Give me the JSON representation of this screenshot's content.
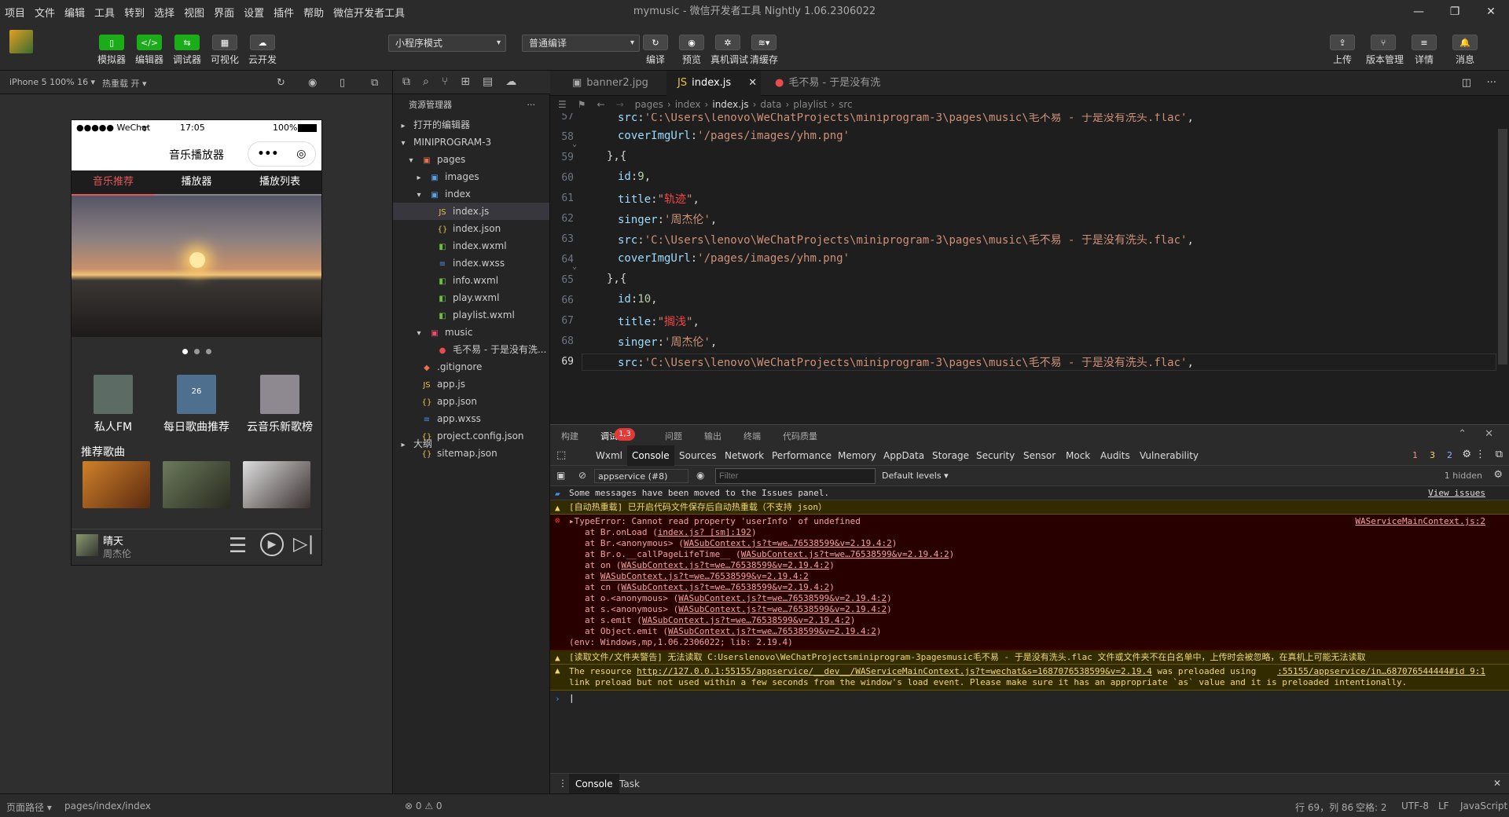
{
  "menu": [
    "项目",
    "文件",
    "编辑",
    "工具",
    "转到",
    "选择",
    "视图",
    "界面",
    "设置",
    "插件",
    "帮助",
    "微信开发者工具"
  ],
  "window": {
    "title": "mymusic - 微信开发者工具 Nightly 1.06.2306022",
    "controls": [
      "—",
      "❐",
      "✕"
    ]
  },
  "toolbar": {
    "left": [
      {
        "label": "模拟器",
        "glyph": "▯"
      },
      {
        "label": "编辑器",
        "glyph": "</>"
      },
      {
        "label": "调试器",
        "glyph": "⇆"
      },
      {
        "label": "可视化",
        "glyph": "▦"
      },
      {
        "label": "云开发",
        "glyph": "☁"
      }
    ],
    "mode_select": "小程序模式",
    "compile_select": "普通编译",
    "mid": [
      {
        "label": "编译",
        "glyph": "↻"
      },
      {
        "label": "预览",
        "glyph": "◉"
      },
      {
        "label": "真机调试",
        "glyph": "✲"
      },
      {
        "label": "清缓存",
        "glyph": "≋▾"
      }
    ],
    "right": [
      {
        "label": "上传",
        "glyph": "⇪"
      },
      {
        "label": "版本管理",
        "glyph": "⑂"
      },
      {
        "label": "详情",
        "glyph": "≡"
      },
      {
        "label": "消息",
        "glyph": "🔔"
      }
    ]
  },
  "simbar": {
    "device": "iPhone 5 100% 16 ▾",
    "hotreload": "热重载 开 ▾"
  },
  "phone": {
    "carrier": "●●●●● WeChat",
    "wifi": "ᯤ",
    "time": "17:05",
    "battery": "100%",
    "title": "音乐播放器",
    "capsule_more": "•••",
    "capsule_close": "◎",
    "tabs": [
      "音乐推荐",
      "播放器",
      "播放列表"
    ],
    "icons": [
      {
        "label": "私人FM",
        "color": "#5c6b64"
      },
      {
        "label": "每日歌曲推荐",
        "color": "#4e6f8e",
        "badge": "26"
      },
      {
        "label": "云音乐新歌榜",
        "color": "#8e8890"
      }
    ],
    "recommend": "推荐歌曲",
    "song": {
      "name": "晴天",
      "singer": "周杰伦"
    }
  },
  "explorer": {
    "title": "资源管理器",
    "more": "···",
    "open_editors": "打开的编辑器",
    "project": "MINIPROGRAM-3",
    "outline": "大纲",
    "tree": [
      {
        "name": "pages",
        "icon": "▣",
        "color": "#e8714b",
        "level": 1,
        "arrow": "▾"
      },
      {
        "name": "images",
        "icon": "▣",
        "color": "#5aa0e8",
        "level": 2,
        "arrow": "▸"
      },
      {
        "name": "index",
        "icon": "▣",
        "color": "#5aa0e8",
        "level": 2,
        "arrow": "▾"
      },
      {
        "name": "index.js",
        "icon": "JS",
        "color": "#e8c34b",
        "level": 3,
        "active": true
      },
      {
        "name": "index.json",
        "icon": "{}",
        "color": "#e8c34b",
        "level": 3
      },
      {
        "name": "index.wxml",
        "icon": "◧",
        "color": "#6abf40",
        "level": 3
      },
      {
        "name": "index.wxss",
        "icon": "≡",
        "color": "#4b8fe8",
        "level": 3
      },
      {
        "name": "info.wxml",
        "icon": "◧",
        "color": "#6abf40",
        "level": 3
      },
      {
        "name": "play.wxml",
        "icon": "◧",
        "color": "#6abf40",
        "level": 3
      },
      {
        "name": "playlist.wxml",
        "icon": "◧",
        "color": "#6abf40",
        "level": 3
      },
      {
        "name": "music",
        "icon": "▣",
        "color": "#e84b6f",
        "level": 2,
        "arrow": "▾"
      },
      {
        "name": "毛不易 - 于是没有洗...",
        "icon": "●",
        "color": "#e84b4b",
        "level": 3
      },
      {
        "name": ".gitignore",
        "icon": "◆",
        "color": "#e8714b",
        "level": 1
      },
      {
        "name": "app.js",
        "icon": "JS",
        "color": "#e8c34b",
        "level": 1
      },
      {
        "name": "app.json",
        "icon": "{}",
        "color": "#e8c34b",
        "level": 1
      },
      {
        "name": "app.wxss",
        "icon": "≡",
        "color": "#4b8fe8",
        "level": 1
      },
      {
        "name": "project.config.json",
        "icon": "{}",
        "color": "#e8c34b",
        "level": 1
      },
      {
        "name": "sitemap.json",
        "icon": "{}",
        "color": "#e8c34b",
        "level": 1
      }
    ]
  },
  "editor": {
    "tabs": [
      {
        "name": "banner2.jpg",
        "icon": "▣"
      },
      {
        "name": "index.js",
        "icon": "JS",
        "active": true,
        "close": "✕"
      },
      {
        "name": "毛不易 - 于是没有洗头.flac",
        "icon": "●"
      }
    ],
    "breadcrumb": [
      "pages",
      "index",
      "index.js",
      "data",
      "playlist",
      "src"
    ],
    "lines": [
      {
        "n": "57",
        "parts": [
          [
            "p",
            "src"
          ],
          [
            "d",
            ":"
          ],
          [
            "s",
            "'C:\\Users\\lenovo\\WeChatProjects\\miniprogram-3\\pages\\music\\毛不易 - 于是没有洗头.flac'"
          ],
          [
            "d",
            ","
          ]
        ]
      },
      {
        "n": "58",
        "parts": [
          [
            "p",
            "coverImgUrl"
          ],
          [
            "d",
            ":"
          ],
          [
            "s",
            "'/pages/images/yhm.png'"
          ]
        ]
      },
      {
        "n": "59",
        "parts": [
          [
            "d",
            "},{"
          ]
        ],
        "indent": -1
      },
      {
        "n": "60",
        "parts": [
          [
            "p",
            "id"
          ],
          [
            "d",
            ":"
          ],
          [
            "n",
            "9"
          ],
          [
            "d",
            ","
          ]
        ]
      },
      {
        "n": "61",
        "parts": [
          [
            "p",
            "title"
          ],
          [
            "d",
            ":"
          ],
          [
            "s",
            "\""
          ],
          [
            "r",
            "轨迹"
          ],
          [
            "s",
            "\""
          ],
          [
            "d",
            ","
          ]
        ]
      },
      {
        "n": "62",
        "parts": [
          [
            "p",
            "singer"
          ],
          [
            "d",
            ":"
          ],
          [
            "s",
            "'周杰伦'"
          ],
          [
            "d",
            ","
          ]
        ]
      },
      {
        "n": "63",
        "parts": [
          [
            "p",
            "src"
          ],
          [
            "d",
            ":"
          ],
          [
            "s",
            "'C:\\Users\\lenovo\\WeChatProjects\\miniprogram-3\\pages\\music\\毛不易 - 于是没有洗头.flac'"
          ],
          [
            "d",
            ","
          ]
        ]
      },
      {
        "n": "64",
        "parts": [
          [
            "p",
            "coverImgUrl"
          ],
          [
            "d",
            ":"
          ],
          [
            "s",
            "'/pages/images/yhm.png'"
          ]
        ]
      },
      {
        "n": "65",
        "parts": [
          [
            "d",
            "},{"
          ]
        ],
        "indent": -1
      },
      {
        "n": "66",
        "parts": [
          [
            "p",
            "id"
          ],
          [
            "d",
            ":"
          ],
          [
            "n",
            "10"
          ],
          [
            "d",
            ","
          ]
        ]
      },
      {
        "n": "67",
        "parts": [
          [
            "p",
            "title"
          ],
          [
            "d",
            ":"
          ],
          [
            "s",
            "\""
          ],
          [
            "r",
            "搁浅"
          ],
          [
            "s",
            "\""
          ],
          [
            "d",
            ","
          ]
        ]
      },
      {
        "n": "68",
        "parts": [
          [
            "p",
            "singer"
          ],
          [
            "d",
            ":"
          ],
          [
            "s",
            "'周杰伦'"
          ],
          [
            "d",
            ","
          ]
        ]
      },
      {
        "n": "69",
        "parts": [
          [
            "p",
            "src"
          ],
          [
            "d",
            ":"
          ],
          [
            "s",
            "'C:\\Users\\lenovo\\WeChatProjects\\miniprogram-3\\pages\\music\\毛不易 - 于是没有洗头.flac'"
          ],
          [
            "d",
            ","
          ]
        ]
      }
    ]
  },
  "console": {
    "top_tabs": [
      "构建",
      "调试器",
      "问题",
      "输出",
      "终端",
      "代码质量"
    ],
    "badge": "1,3",
    "tabs": [
      "Wxml",
      "Console",
      "Sources",
      "Network",
      "Performance",
      "Memory",
      "AppData",
      "Storage",
      "Security",
      "Sensor",
      "Mock",
      "Audits",
      "Vulnerability"
    ],
    "counts": {
      "errors": "1",
      "warnings": "3",
      "info": "2"
    },
    "context": "appservice (#8)",
    "filter_placeholder": "Filter",
    "levels": "Default levels ▾",
    "hidden": "1 hidden",
    "info_msg": "Some messages have been moved to the Issues panel.",
    "view_issues": "View issues",
    "warn1": "[自动热重载] 已开启代码文件保存后自动热重载（不支持 json）",
    "error_title": "▸TypeError: Cannot read property 'userInfo' of undefined",
    "error_src": "WAServiceMainContext.js:2",
    "stack": [
      [
        "at Br.onLoad (",
        "index.js? [sm]:192",
        ")"
      ],
      [
        "at Br.<anonymous> (",
        "WASubContext.js?t=we…76538599&v=2.19.4:2",
        ")"
      ],
      [
        "at Br.o.__callPageLifeTime__ (",
        "WASubContext.js?t=we…76538599&v=2.19.4:2",
        ")"
      ],
      [
        "at on (",
        "WASubContext.js?t=we…76538599&v=2.19.4:2",
        ")"
      ],
      [
        "at ",
        "WASubContext.js?t=we…76538599&v=2.19.4:2",
        ""
      ],
      [
        "at cn (",
        "WASubContext.js?t=we…76538599&v=2.19.4:2",
        ")"
      ],
      [
        "at o.<anonymous> (",
        "WASubContext.js?t=we…76538599&v=2.19.4:2",
        ")"
      ],
      [
        "at s.<anonymous> (",
        "WASubContext.js?t=we…76538599&v=2.19.4:2",
        ")"
      ],
      [
        "at s.emit (",
        "WASubContext.js?t=we…76538599&v=2.19.4:2",
        ")"
      ],
      [
        "at Object.emit (",
        "WASubContext.js?t=we…76538599&v=2.19.4:2",
        ")"
      ]
    ],
    "env": "(env: Windows,mp,1.06.2306022; lib: 2.19.4)",
    "warn2": "[读取文件/文件夹警告] 无法读取 C:Userslenovo\\WeChatProjectsminiprogram-3pagesmusic毛不易 - 于是没有洗头.flac 文件或文件夹不在白名单中，上传时会被忽略，在真机上可能无法读取",
    "warn3a": "The resource ",
    "warn3url": "http://127.0.0.1:55155/appservice/__dev__/WAServiceMainContext.js?t=wechat&s=1687076538599&v=2.19.4",
    "warn3b": " was preloaded using",
    "warn3src": ":55155/appservice/in…687076544444#id 9:1",
    "warn3c": "link preload but not used within a few seconds from the window's load event. Please make sure it has an appropriate `as` value and it is preloaded intentionally.",
    "prompt": "›",
    "bottom_tabs": [
      "Console",
      "Task"
    ]
  },
  "statusbar": {
    "path_label": "页面路径 ▾",
    "path": "pages/index/index",
    "problems": "⊗ 0 ⚠ 0",
    "cursor": "行 69，列 86",
    "spaces": "空格: 2",
    "encoding": "UTF-8",
    "eol": "LF",
    "lang": "JavaScript"
  }
}
